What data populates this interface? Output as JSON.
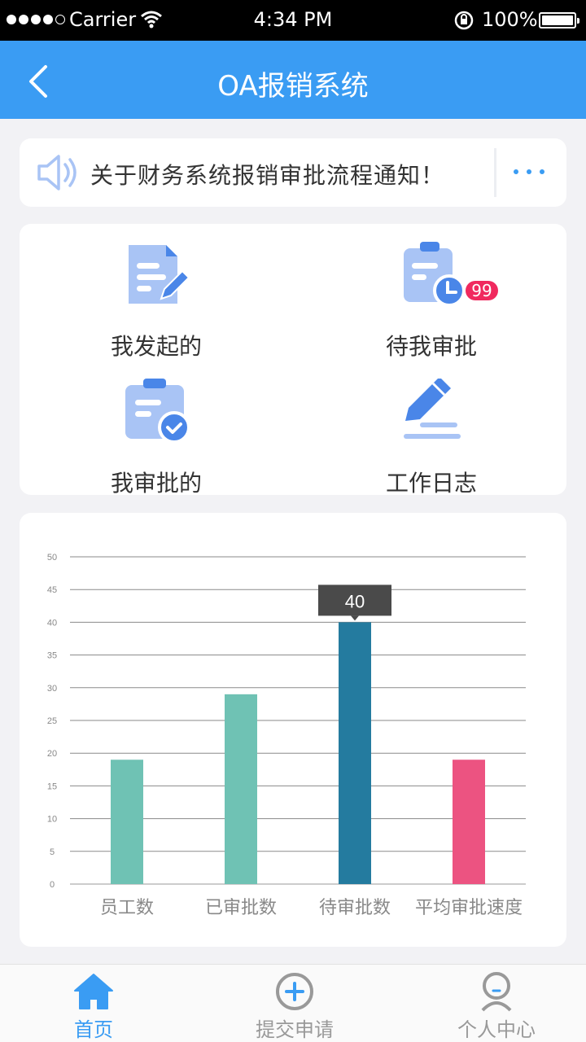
{
  "status_bar": {
    "carrier": "Carrier",
    "time": "4:34 PM",
    "battery": "100%"
  },
  "nav": {
    "title": "OA报销系统"
  },
  "notice": {
    "text": "关于财务系统报销审批流程通知！"
  },
  "grid": {
    "items": [
      {
        "label": "我发起的",
        "icon": "document-edit-icon"
      },
      {
        "label": "待我审批",
        "icon": "clipboard-clock-icon",
        "badge": "99"
      },
      {
        "label": "我审批的",
        "icon": "clipboard-check-icon"
      },
      {
        "label": "工作日志",
        "icon": "pencil-line-icon"
      }
    ]
  },
  "chart_data": {
    "type": "bar",
    "categories": [
      "员工数",
      "已审批数",
      "待审批数",
      "平均审批速度"
    ],
    "values": [
      19,
      29,
      40,
      19
    ],
    "colors": [
      "#6fc2b4",
      "#6fc2b4",
      "#247b9f",
      "#ec5381"
    ],
    "ylim": [
      0,
      50
    ],
    "yticks": [
      0,
      5,
      10,
      15,
      20,
      25,
      30,
      35,
      40,
      45,
      50
    ],
    "tooltip": {
      "category": "待审批数",
      "value": "40"
    },
    "grid": true
  },
  "tabs": [
    {
      "label": "首页",
      "icon": "home-icon",
      "active": true
    },
    {
      "label": "提交申请",
      "icon": "plus-circle-icon",
      "active": false
    },
    {
      "label": "个人中心",
      "icon": "user-icon",
      "active": false
    }
  ],
  "colors": {
    "primary": "#3a9cf3",
    "badge": "#f0295e",
    "icon_light": "#a9c4f5",
    "icon_dark": "#4a86e8"
  }
}
